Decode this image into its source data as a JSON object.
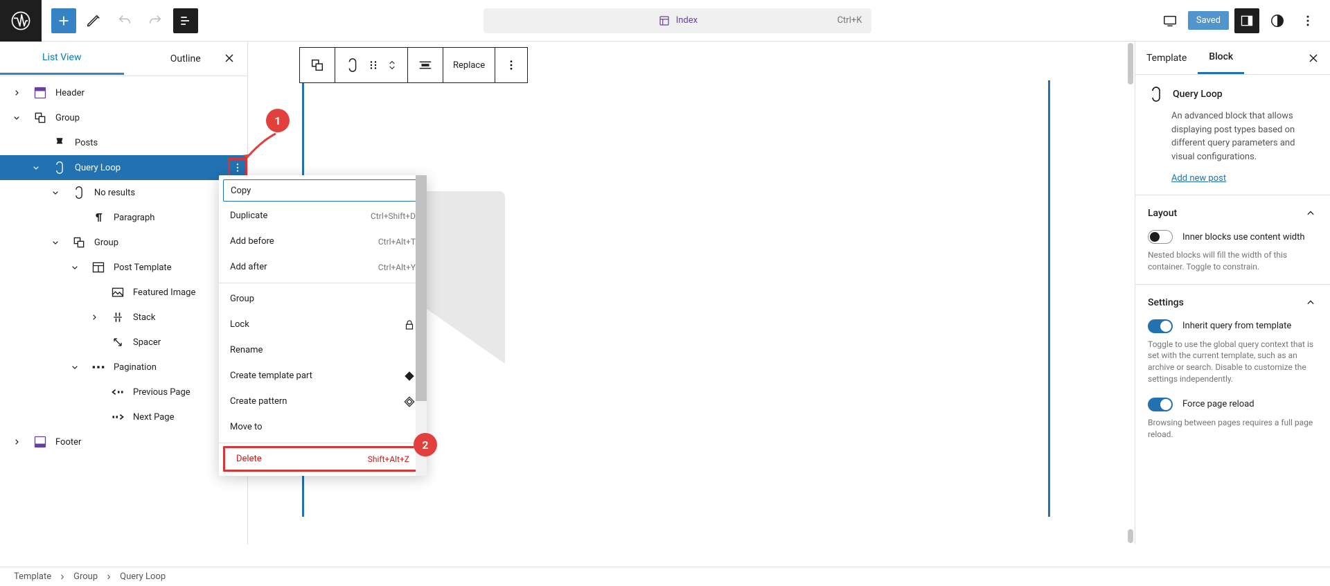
{
  "topbar": {
    "document": "Index",
    "shortcut": "Ctrl+K",
    "saved": "Saved"
  },
  "list_view": {
    "tabs": {
      "list": "List View",
      "outline": "Outline"
    },
    "tree": [
      {
        "label": "Header",
        "indent": 0,
        "icon": "header",
        "tog": "right"
      },
      {
        "label": "Group",
        "indent": 0,
        "icon": "group",
        "tog": "down"
      },
      {
        "label": "Posts",
        "indent": 1,
        "icon": "pin",
        "tog": ""
      },
      {
        "label": "Query Loop",
        "indent": 1,
        "icon": "loop",
        "tog": "down",
        "sel": true,
        "opts": true
      },
      {
        "label": "No results",
        "indent": 2,
        "icon": "loop",
        "tog": "down"
      },
      {
        "label": "Paragraph",
        "indent": 3,
        "icon": "para",
        "tog": ""
      },
      {
        "label": "Group",
        "indent": 2,
        "icon": "group",
        "tog": "down"
      },
      {
        "label": "Post Template",
        "indent": 3,
        "icon": "layout",
        "tog": "down"
      },
      {
        "label": "Featured Image",
        "indent": 4,
        "icon": "img",
        "tog": ""
      },
      {
        "label": "Stack",
        "indent": 4,
        "icon": "stack",
        "tog": "right"
      },
      {
        "label": "Spacer",
        "indent": 4,
        "icon": "spacer",
        "tog": ""
      },
      {
        "label": "Pagination",
        "indent": 3,
        "icon": "pagi",
        "tog": "down"
      },
      {
        "label": "Previous Page",
        "indent": 4,
        "icon": "prev",
        "tog": ""
      },
      {
        "label": "Next Page",
        "indent": 4,
        "icon": "next",
        "tog": ""
      },
      {
        "label": "Footer",
        "indent": 0,
        "icon": "footer",
        "tog": "right"
      }
    ]
  },
  "context_menu": {
    "items": [
      {
        "label": "Copy",
        "shortcut": "",
        "first": true
      },
      {
        "label": "Duplicate",
        "shortcut": "Ctrl+Shift+D"
      },
      {
        "label": "Add before",
        "shortcut": "Ctrl+Alt+T"
      },
      {
        "label": "Add after",
        "shortcut": "Ctrl+Alt+Y"
      },
      {
        "sep": true
      },
      {
        "label": "Group",
        "shortcut": ""
      },
      {
        "label": "Lock",
        "shortcut": "",
        "icon": "lock"
      },
      {
        "label": "Rename",
        "shortcut": ""
      },
      {
        "label": "Create template part",
        "shortcut": "",
        "icon": "tpart"
      },
      {
        "label": "Create pattern",
        "shortcut": "",
        "icon": "pattern"
      },
      {
        "label": "Move to",
        "shortcut": ""
      },
      {
        "sep": true
      },
      {
        "label": "Delete",
        "shortcut": "Shift+Alt+Z",
        "del": true
      }
    ]
  },
  "float_toolbar": {
    "replace": "Replace"
  },
  "badges": {
    "b1": "1",
    "b2": "2"
  },
  "inspector": {
    "tabs": {
      "template": "Template",
      "block": "Block"
    },
    "block": {
      "name": "Query Loop",
      "desc": "An advanced block that allows displaying post types based on different query parameters and visual configurations.",
      "add_new": "Add new post"
    },
    "layout": {
      "title": "Layout",
      "toggle_label": "Inner blocks use content width",
      "help": "Nested blocks will fill the width of this container. Toggle to constrain."
    },
    "settings": {
      "title": "Settings",
      "inherit_label": "Inherit query from template",
      "inherit_help": "Toggle to use the global query context that is set with the current template, such as an archive or search. Disable to customize the settings independently.",
      "force_label": "Force page reload",
      "force_help": "Browsing between pages requires a full page reload."
    }
  },
  "breadcrumb": [
    "Template",
    "Group",
    "Query Loop"
  ]
}
